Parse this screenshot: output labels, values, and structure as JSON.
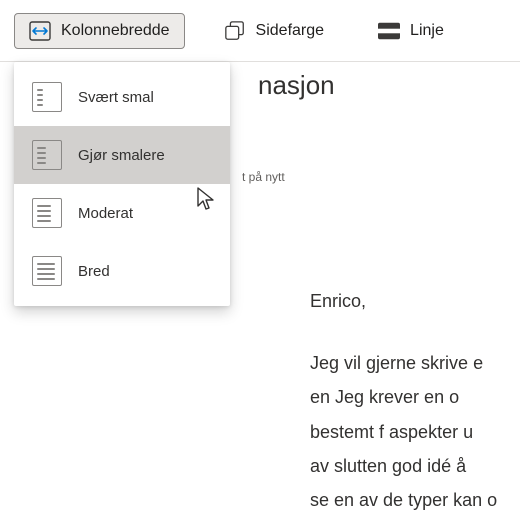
{
  "toolbar": {
    "columnWidth": "Kolonnebredde",
    "pageColor": "Sidefarge",
    "line": "Linje"
  },
  "dropdown": {
    "items": [
      {
        "label": "Svært smal"
      },
      {
        "label": "Gjør smalere"
      },
      {
        "label": "Moderat"
      },
      {
        "label": "Bred"
      }
    ]
  },
  "page": {
    "titleFragment": "nasjon",
    "subtitleFragment": "t på nytt",
    "greeting": "Enrico,",
    "body": "Jeg vil gjerne skrive e\nen Jeg krever en     o\nbestemt f aspekter   u\nav slutten god idé å\nse en av de typer kan o"
  }
}
